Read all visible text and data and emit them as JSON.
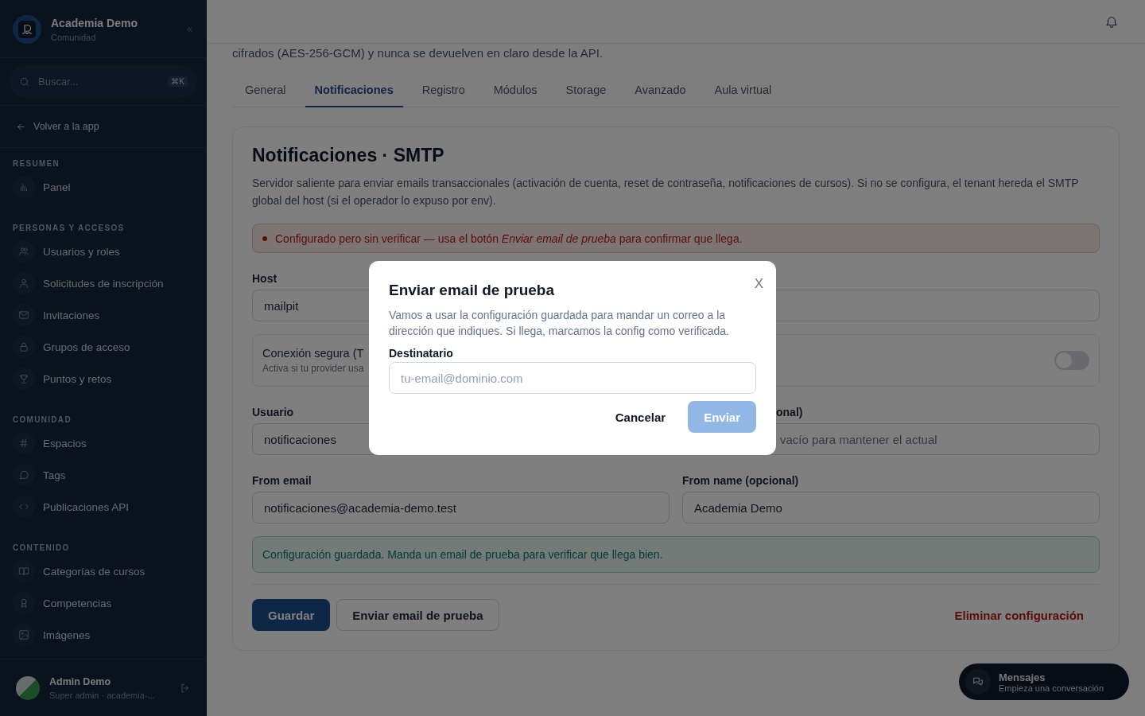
{
  "sidebar": {
    "brand": {
      "title": "Academia Demo",
      "subtitle": "Comunidad"
    },
    "search": {
      "placeholder": "Buscar...",
      "shortcut": "⌘K"
    },
    "back_link": "Volver a la app",
    "sections": [
      {
        "title": "RESUMEN",
        "items": [
          {
            "label": "Panel"
          }
        ]
      },
      {
        "title": "PERSONAS Y ACCESOS",
        "items": [
          {
            "label": "Usuarios y roles"
          },
          {
            "label": "Solicitudes de inscripción"
          },
          {
            "label": "Invitaciones"
          },
          {
            "label": "Grupos de acceso"
          },
          {
            "label": "Puntos y retos"
          }
        ]
      },
      {
        "title": "COMUNIDAD",
        "items": [
          {
            "label": "Espacios"
          },
          {
            "label": "Tags"
          },
          {
            "label": "Publicaciones API"
          }
        ]
      },
      {
        "title": "CONTENIDO",
        "items": [
          {
            "label": "Categorías de cursos"
          },
          {
            "label": "Competencias"
          },
          {
            "label": "Imágenes"
          }
        ]
      }
    ],
    "user": {
      "name": "Admin Demo",
      "role": "Super admin · academia-..."
    }
  },
  "intro_tail": "cifrados (AES-256-GCM) y nunca se devuelven en claro desde la API.",
  "tabs": [
    {
      "label": "General",
      "selected": false
    },
    {
      "label": "Notificaciones",
      "selected": true
    },
    {
      "label": "Registro",
      "selected": false
    },
    {
      "label": "Módulos",
      "selected": false
    },
    {
      "label": "Storage",
      "selected": false
    },
    {
      "label": "Avanzado",
      "selected": false
    },
    {
      "label": "Aula virtual",
      "selected": false
    }
  ],
  "card": {
    "title": "Notificaciones · SMTP",
    "description": "Servidor saliente para enviar emails transaccionales (activación de cuenta, reset de contraseña, notificaciones de cursos). Si no se configura, el tenant hereda el SMTP global del host (si el operador lo expuso por env).",
    "alert": {
      "kind": "warning",
      "text": "Configurado pero sin verificar — usa el botón *Enviar email de prueba* para confirmar que llega."
    },
    "host": {
      "label": "Host",
      "value": "mailpit"
    },
    "toggle": {
      "label": "Conexión segura (T",
      "hint": "Activa si tu provider usa",
      "on": false
    },
    "user": {
      "label": "Usuario",
      "value": "notificaciones"
    },
    "password": {
      "label": "onal)",
      "placeholder": "vacío para mantener el actual"
    },
    "from_email": {
      "label": "From email",
      "value": "notificaciones@academia-demo.test"
    },
    "from_name": {
      "label": "From name (opcional)",
      "value": "Academia Demo"
    },
    "notice": {
      "kind": "success",
      "text": "Configuración guardada. Manda un email de prueba para verificar que llega bien."
    },
    "buttons": [
      {
        "label": "Guardar",
        "kind": "primary"
      },
      {
        "label": "Enviar email de prueba",
        "kind": "secondary"
      },
      {
        "label": "Eliminar configuración",
        "kind": "danger"
      }
    ]
  },
  "chat": {
    "title": "Mensajes",
    "subtitle": "Empieza una conversación"
  },
  "modal": {
    "title": "Enviar email de prueba",
    "close": "X",
    "description": "Vamos a usar la configuración guardada para mandar un correo a la dirección que indiques. Si llega, marcamos la config como verificada.",
    "field": {
      "label": "Destinatario",
      "placeholder": "tu-email@dominio.com"
    },
    "buttons": [
      {
        "label": "Cancelar",
        "kind": "ghost"
      },
      {
        "label": "Enviar",
        "kind": "primary",
        "disabled": true
      }
    ]
  }
}
